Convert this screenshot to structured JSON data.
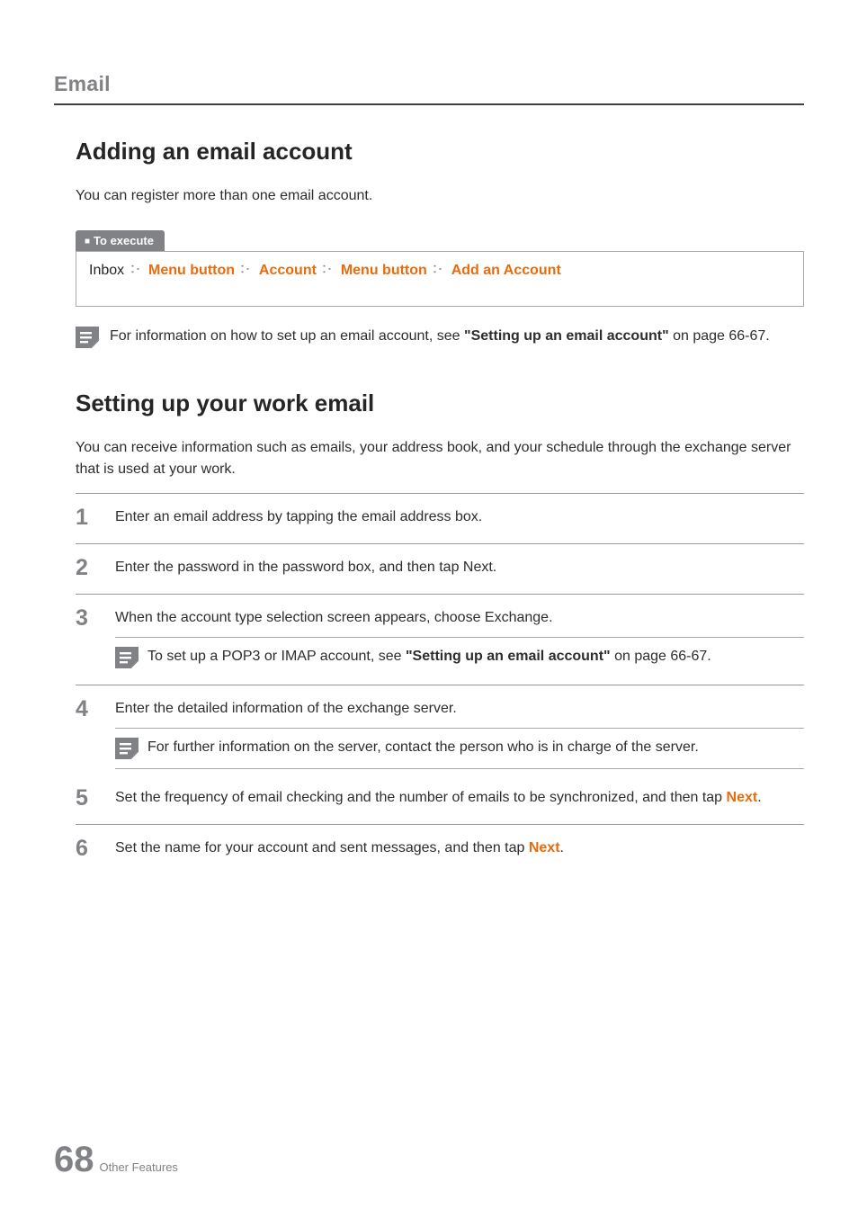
{
  "header": {
    "section": "Email"
  },
  "section1": {
    "title": "Adding an email account",
    "intro": "You can register more than one email account.",
    "execute": {
      "tab": "To execute",
      "parts": {
        "p0": "Inbox",
        "p1": "Menu button",
        "p2": "Account",
        "p3": "Menu button",
        "p4": "Add an Account"
      }
    },
    "note": {
      "pre": "For information on how to set up an email account, see ",
      "bold": "\"Setting up an email account\"",
      "post": " on page 66-67."
    }
  },
  "section2": {
    "title": "Setting up your work email",
    "intro": "You can receive information such as emails, your address book, and your schedule through the exchange server that is used at your work.",
    "steps": {
      "s1": {
        "num": "1",
        "text": "Enter an email address by tapping the email address box."
      },
      "s2": {
        "num": "2",
        "text": "Enter the password in the password box, and then tap Next."
      },
      "s3": {
        "num": "3",
        "text": "When the account type selection screen appears, choose Exchange.",
        "note": {
          "pre": "To set up a POP3 or IMAP account, see ",
          "bold": "\"Setting up an email account\"",
          "post": " on page 66-67."
        }
      },
      "s4": {
        "num": "4",
        "text": "Enter the detailed information of the exchange server.",
        "note": {
          "text": "For further information on the server, contact the person who is in charge of the server."
        }
      },
      "s5": {
        "num": "5",
        "pre": "Set the frequency of email checking and the number of emails to be synchronized, and then tap ",
        "orange": "Next",
        "post": "."
      },
      "s6": {
        "num": "6",
        "pre": "Set the name for your account and sent messages, and then tap ",
        "orange": "Next",
        "post": "."
      }
    }
  },
  "footer": {
    "page": "68",
    "label": "Other Features"
  }
}
